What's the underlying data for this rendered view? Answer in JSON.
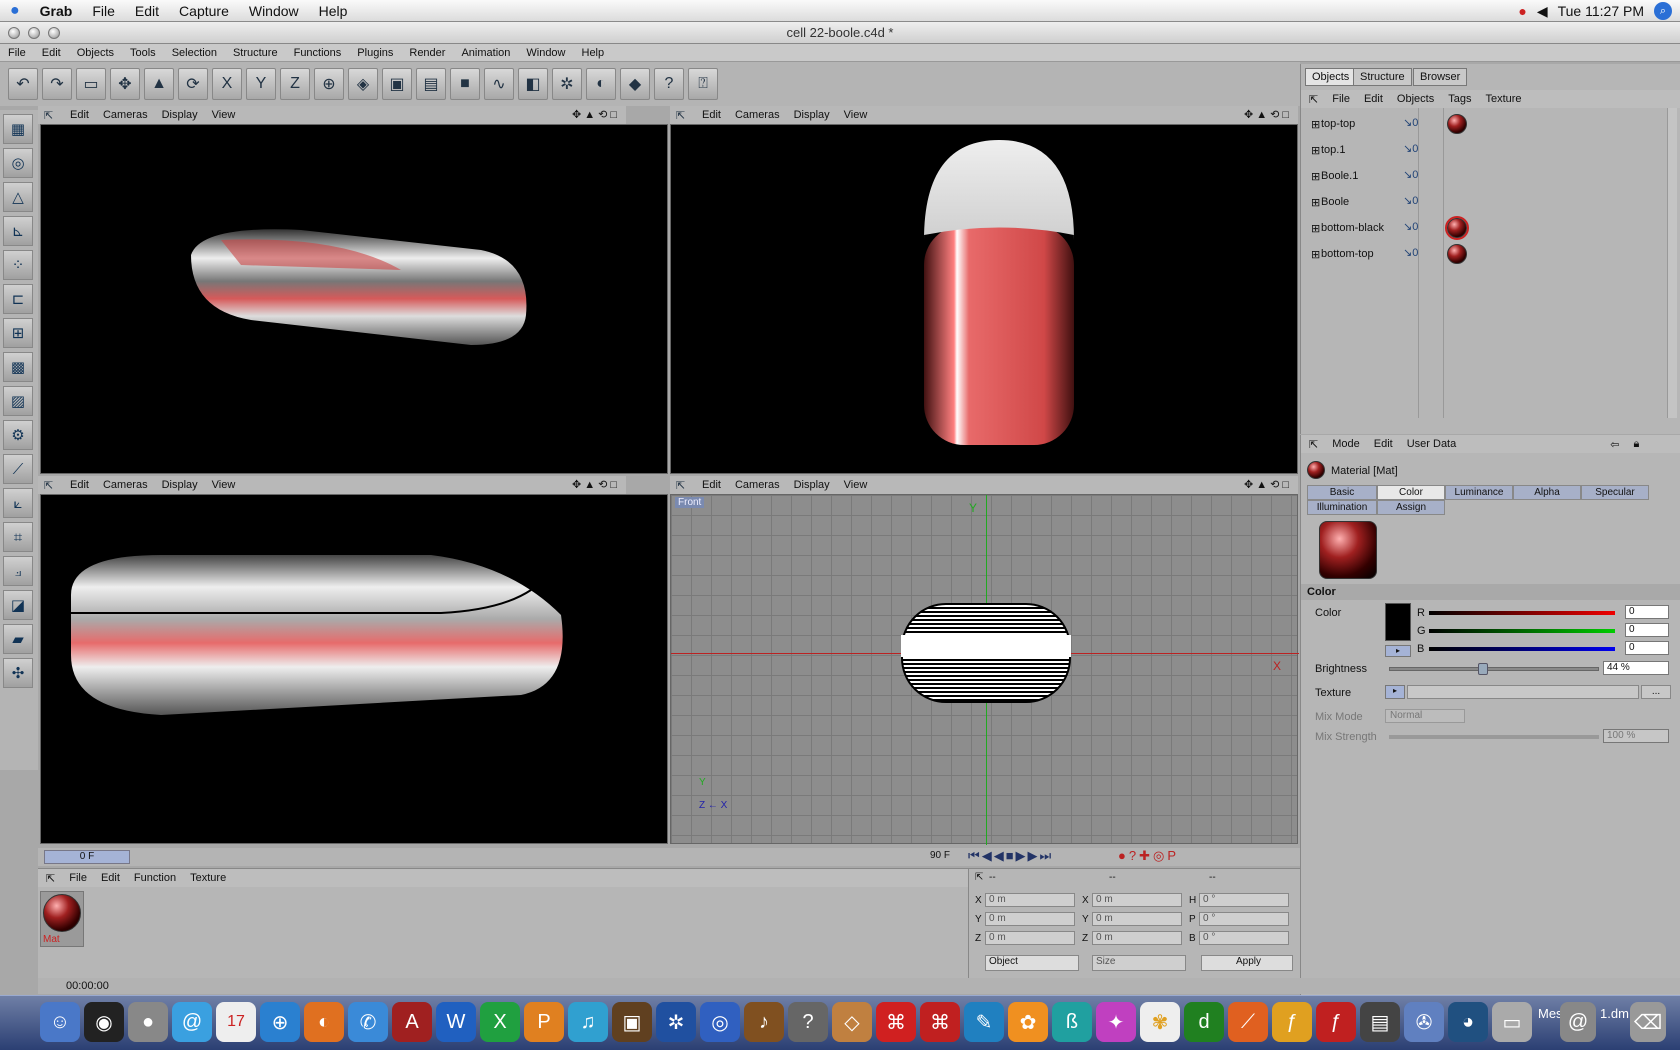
{
  "menubar": {
    "apple": "",
    "items": [
      "Grab",
      "File",
      "Edit",
      "Capture",
      "Window",
      "Help"
    ],
    "clock": "Tue 11:27 PM"
  },
  "window": {
    "title": "cell 22-boole.c4d *"
  },
  "app_menu": [
    "File",
    "Edit",
    "Objects",
    "Tools",
    "Selection",
    "Structure",
    "Functions",
    "Plugins",
    "Render",
    "Animation",
    "Window",
    "Help"
  ],
  "viewport_menu": [
    "Edit",
    "Cameras",
    "Display",
    "View"
  ],
  "front_view": {
    "label": "Front",
    "axis_y": "Y",
    "axis_x": "X",
    "corner_y": "Y",
    "corner_zx": "Z ← X"
  },
  "objects_panel": {
    "tabs": [
      "Objects",
      "Structure",
      "Browser"
    ],
    "menu": [
      "File",
      "Edit",
      "Objects",
      "Tags",
      "Texture"
    ],
    "objects": [
      {
        "name": "top-top",
        "check": "↘0",
        "has_material": true
      },
      {
        "name": "top.1",
        "check": "↘0",
        "has_material": false
      },
      {
        "name": "Boole.1",
        "check": "↘0",
        "has_material": false
      },
      {
        "name": "Boole",
        "check": "↘0",
        "has_material": false
      },
      {
        "name": "bottom-black",
        "check": "↘0",
        "has_material": true
      },
      {
        "name": "bottom-top",
        "check": "↘0",
        "has_material": true
      }
    ]
  },
  "attributes": {
    "menu": [
      "Mode",
      "Edit",
      "User Data"
    ],
    "header": "Material [Mat]",
    "tabs_row1": [
      "Basic",
      "Color",
      "Luminance",
      "Alpha",
      "Specular"
    ],
    "tabs_row2": [
      "Illumination",
      "Assign"
    ],
    "selected_tab": "Color",
    "section": "Color",
    "color_label": "Color",
    "r_label": "R",
    "r_value": "0",
    "g_label": "G",
    "g_value": "0",
    "b_label": "B",
    "b_value": "0",
    "brightness_label": "Brightness",
    "brightness_value": "44 %",
    "brightness_fraction": 0.44,
    "texture_label": "Texture",
    "texture_btn": "...",
    "mix_mode_label": "Mix Mode",
    "mix_mode_value": "Normal",
    "mix_strength_label": "Mix Strength",
    "mix_strength_value": "100 %"
  },
  "timeline": {
    "start": "0 F",
    "end": "90 F"
  },
  "material_manager": {
    "menu": [
      "File",
      "Edit",
      "Function",
      "Texture"
    ],
    "material_name": "Mat"
  },
  "coords": {
    "header": [
      "--",
      "--",
      "--"
    ],
    "rows": [
      {
        "a": "X",
        "av": "0 m",
        "b": "X",
        "bv": "0 m",
        "c": "H",
        "cv": "0 °"
      },
      {
        "a": "Y",
        "av": "0 m",
        "b": "Y",
        "bv": "0 m",
        "c": "P",
        "cv": "0 °"
      },
      {
        "a": "Z",
        "av": "0 m",
        "b": "Z",
        "bv": "0 m",
        "c": "B",
        "cv": "0 °"
      }
    ],
    "mode": "Object",
    "size": "Size",
    "apply": "Apply"
  },
  "status": {
    "time": "00:00:00"
  },
  "dock": {
    "cal_day": "17",
    "right_label_1": "Mes",
    "right_label_2": "1.dm"
  }
}
